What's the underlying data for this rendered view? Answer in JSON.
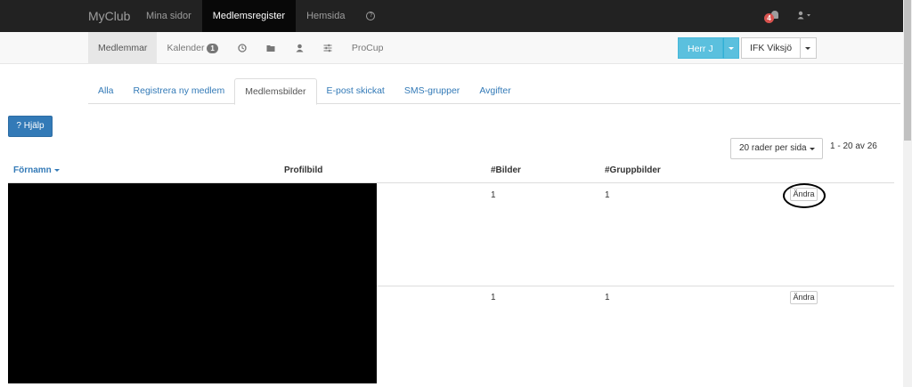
{
  "topbar": {
    "brand": "MyClub",
    "items": [
      {
        "label": "Mina sidor",
        "active": false
      },
      {
        "label": "Medlemsregister",
        "active": true
      },
      {
        "label": "Hemsida",
        "active": false
      }
    ],
    "help_icon": "?",
    "notification_count": "4",
    "user_icon": "user-icon"
  },
  "subnav": {
    "medlemmar": "Medlemmar",
    "kalender": "Kalender",
    "kalender_count": "1",
    "procup": "ProCup",
    "icons": [
      "clock-icon",
      "folder-icon",
      "user-icon",
      "sliders-icon"
    ]
  },
  "account_button": "Herr J",
  "club_button": "IFK Viksjö",
  "tabs": [
    "Alla",
    "Registrera ny medlem",
    "Medlemsbilder",
    "E-post skickat",
    "SMS-grupper",
    "Avgifter"
  ],
  "active_tab": "Medlemsbilder",
  "help_button": "? Hjälp",
  "pagination": {
    "rows_per_page": "20 rader per sida",
    "range": "1 - 20 av 26"
  },
  "table": {
    "headers": {
      "fornamn": "Förnamn",
      "profilbild": "Profilbild",
      "bilder": "#Bilder",
      "gruppbilder": "#Gruppbilder"
    },
    "rows": [
      {
        "bilder": "1",
        "gruppbilder": "1",
        "action": "Ändra"
      },
      {
        "bilder": "1",
        "gruppbilder": "1",
        "action": "Ändra"
      }
    ]
  },
  "colors": {
    "navbar": "#222222",
    "link": "#337ab7",
    "info_button": "#5bc0de",
    "badge": "#d9534f"
  }
}
